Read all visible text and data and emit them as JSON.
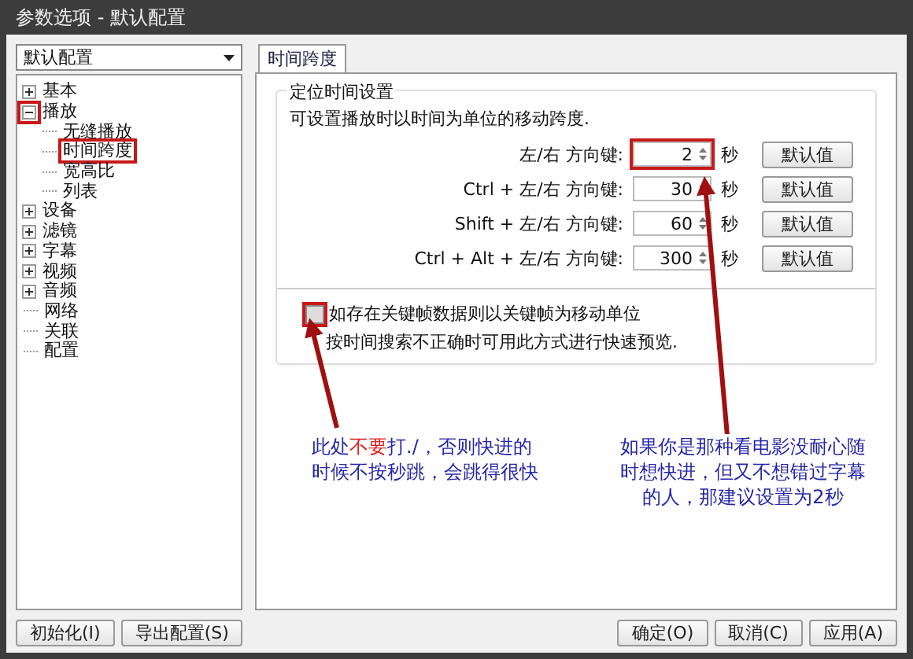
{
  "window": {
    "title": "参数选项 - 默认配置"
  },
  "profile_dropdown": {
    "value": "默认配置"
  },
  "tree": [
    {
      "label": "基本",
      "expanded": false,
      "highlighted": false
    },
    {
      "label": "播放",
      "expanded": true,
      "highlighted": true,
      "children": [
        {
          "label": "无缝播放",
          "highlighted": false
        },
        {
          "label": "时间跨度",
          "highlighted": true
        },
        {
          "label": "宽高比",
          "highlighted": false
        },
        {
          "label": "列表",
          "highlighted": false
        }
      ]
    },
    {
      "label": "设备",
      "expanded": false,
      "highlighted": false
    },
    {
      "label": "滤镜",
      "expanded": false,
      "highlighted": false
    },
    {
      "label": "字幕",
      "expanded": false,
      "highlighted": false
    },
    {
      "label": "视频",
      "expanded": false,
      "highlighted": false
    },
    {
      "label": "音频",
      "expanded": false,
      "highlighted": false
    },
    {
      "label": "网络"
    },
    {
      "label": "关联"
    },
    {
      "label": "配置"
    }
  ],
  "tabs": [
    {
      "label": "时间跨度",
      "selected": true
    }
  ],
  "group": {
    "title": "定位时间设置",
    "description": "可设置播放时以时间为单位的移动跨度.",
    "rows": [
      {
        "label": "左/右 方向键:",
        "value": "2",
        "unit": "秒",
        "button": "默认值",
        "highlighted": true
      },
      {
        "label": "Ctrl + 左/右 方向键:",
        "value": "30",
        "unit": "秒",
        "button": "默认值",
        "highlighted": false
      },
      {
        "label": "Shift + 左/右 方向键:",
        "value": "60",
        "unit": "秒",
        "button": "默认值",
        "highlighted": false
      },
      {
        "label": "Ctrl + Alt + 左/右 方向键:",
        "value": "300",
        "unit": "秒",
        "button": "默认值",
        "highlighted": false
      }
    ],
    "keyframe_option": {
      "label": "如存在关键帧数据则以关键帧为移动单位",
      "note": "按时间搜索不正确时可用此方式进行快速预览.",
      "checked": false,
      "highlighted": true
    }
  },
  "annotations": [
    {
      "parts": [
        {
          "text": "此处",
          "emphasis": false
        },
        {
          "text": "不要",
          "emphasis": true
        },
        {
          "text": "打./，否则快进的时候不按秒跳，会跳得很快",
          "emphasis": false
        }
      ]
    },
    {
      "parts": [
        {
          "text": "如果你是那种看电影没耐心随时想快进，但又不想错过字幕的人，那建议设置为2秒",
          "emphasis": false
        }
      ]
    }
  ],
  "footer_left": [
    "初始化(I)",
    "导出配置(S)"
  ],
  "footer_right": [
    "确定(O)",
    "取消(C)",
    "应用(A)"
  ]
}
